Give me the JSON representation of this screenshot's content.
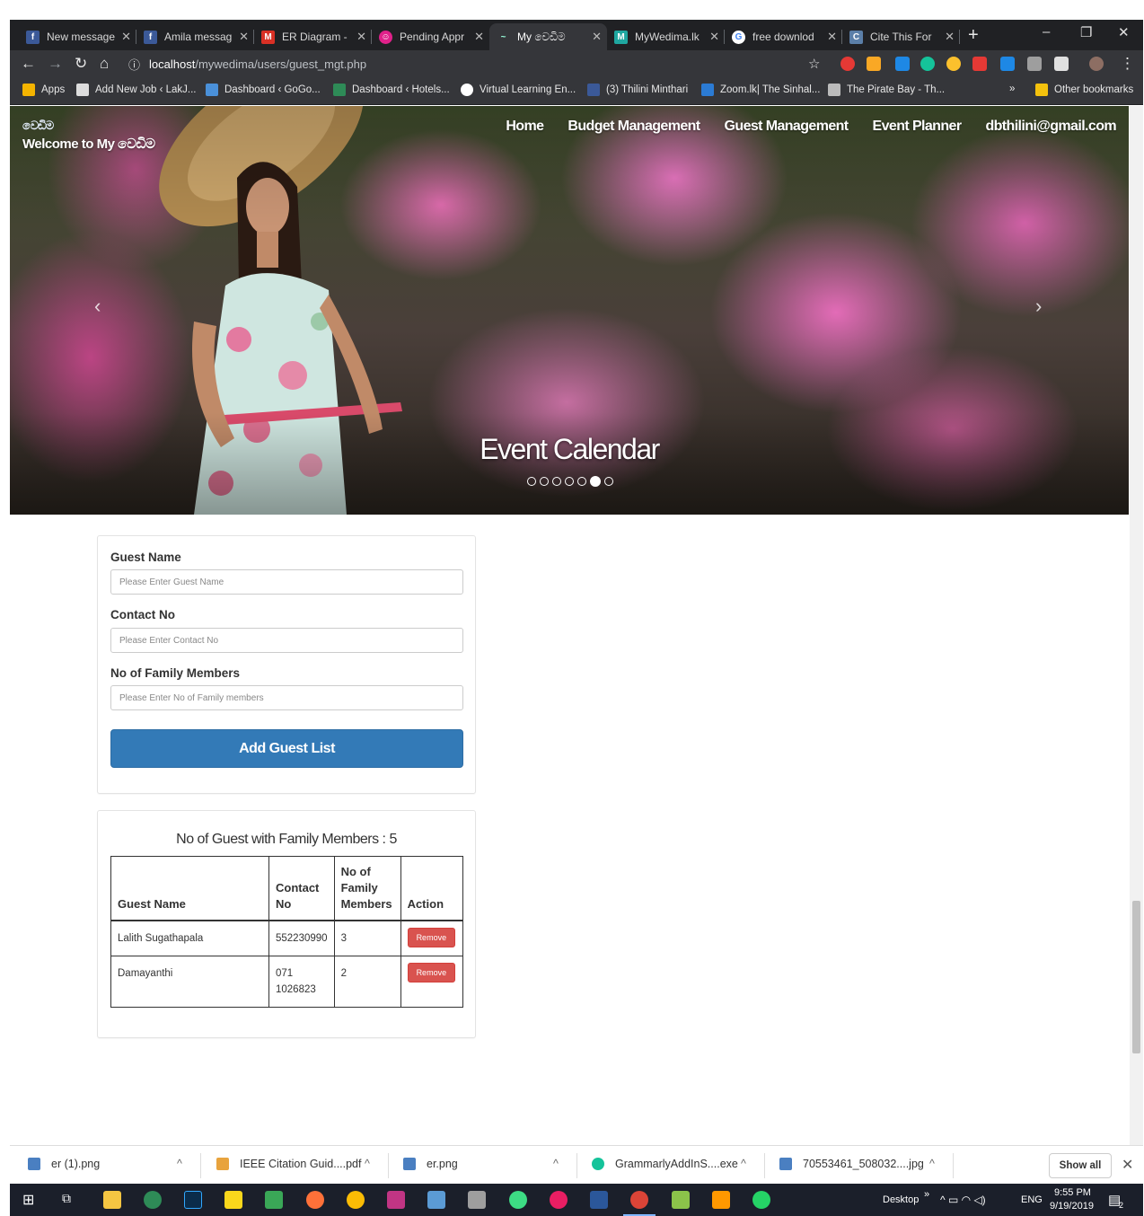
{
  "browser": {
    "tabs": [
      {
        "title": "New message",
        "color": "#3b5998",
        "glyph": "f"
      },
      {
        "title": "Amila messag",
        "color": "#3b5998",
        "glyph": "f"
      },
      {
        "title": "ER Diagram - ",
        "color": "#d93025",
        "glyph": "M"
      },
      {
        "title": "Pending Appr",
        "color": "#e0218a",
        "glyph": "☺"
      },
      {
        "title": "My වෙඩිම",
        "color": "#35363a",
        "glyph": "~"
      },
      {
        "title": "MyWedima.lk",
        "color": "#1fa7a0",
        "glyph": "M"
      },
      {
        "title": "free downlod",
        "color": "#ffffff",
        "glyph": "G"
      },
      {
        "title": "Cite This For",
        "color": "#5b7fa8",
        "glyph": "C"
      }
    ],
    "active_tab": 4,
    "url_host": "localhost",
    "url_path": "/mywedima/users/guest_mgt.php",
    "bookmarks": [
      {
        "label": "Apps",
        "color": "#f4b400"
      },
      {
        "label": "Add New Job ‹ LakJ...",
        "color": "#ddd"
      },
      {
        "label": "Dashboard ‹ GoGo...",
        "color": "#4a90d9"
      },
      {
        "label": "Dashboard ‹ Hotels...",
        "color": "#2e8b57"
      },
      {
        "label": "Virtual Learning En...",
        "color": "#fff"
      },
      {
        "label": "(3) Thilini Minthari",
        "color": "#3b5998"
      },
      {
        "label": "Zoom.lk| The Sinhal...",
        "color": "#2b7bd4"
      },
      {
        "label": "The Pirate Bay - Th...",
        "color": "#bbb"
      }
    ],
    "more_bookmarks": "»",
    "other_bookmarks": "Other bookmarks"
  },
  "site": {
    "logo_text": "වෙඩිම",
    "welcome": "Welcome to My වෙඩිම",
    "nav": [
      "Home",
      "Budget Management",
      "Guest Management",
      "Event Planner",
      "dbthilini@gmail.com"
    ],
    "slide_caption": "Event Calendar",
    "slide_count": 7,
    "slide_active": 5
  },
  "form": {
    "guest_name_label": "Guest Name",
    "guest_name_placeholder": "Please Enter Guest Name",
    "contact_label": "Contact No",
    "contact_placeholder": "Please Enter Contact No",
    "family_label": "No of Family Members",
    "family_placeholder": "Please Enter No of Family members",
    "submit_label": "Add Guest List"
  },
  "guests": {
    "summary": "No of Guest with Family Members : 5",
    "columns": [
      "Guest Name",
      "Contact No",
      "No of Family Members",
      "Action"
    ],
    "rows": [
      {
        "name": "Lalith Sugathapala",
        "contact": "552230990",
        "members": "3",
        "action": "Remove"
      },
      {
        "name": "Damayanthi",
        "contact": "071 1026823",
        "members": "2",
        "action": "Remove"
      }
    ]
  },
  "downloads": {
    "items": [
      {
        "name": "er (1).png",
        "color": "#4a7fc1"
      },
      {
        "name": "IEEE Citation Guid....pdf",
        "color": "#e8a33d"
      },
      {
        "name": "er.png",
        "color": "#4a7fc1"
      },
      {
        "name": "GrammarlyAddInS....exe",
        "color": "#15c39a"
      },
      {
        "name": "70553461_508032....jpg",
        "color": "#4a7fc1"
      }
    ],
    "show_all": "Show all"
  },
  "taskbar": {
    "desktop_label": "Desktop",
    "language": "ENG",
    "time": "9:55 PM",
    "date": "9/19/2019",
    "notification_count": "2",
    "chevrons": "»"
  }
}
